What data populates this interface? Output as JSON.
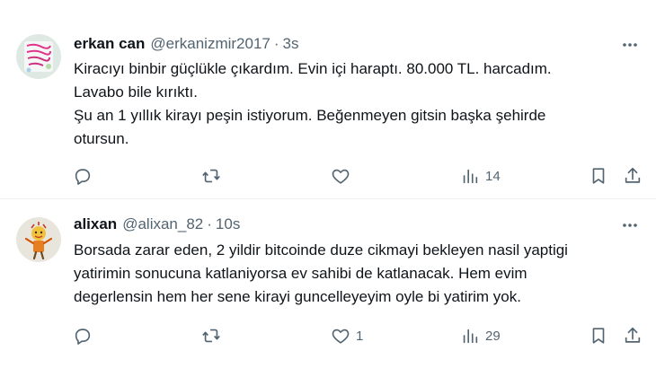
{
  "tweets": [
    {
      "author": {
        "name": "erkan can",
        "handle": "@erkanizmir2017",
        "avatar_icon": "avatar-pink-sticker"
      },
      "separator": "·",
      "time": "3s",
      "text_lines": [
        "Kiracıyı binbir güçlükle çıkardım. Evin içi haraptı. 80.000 TL. harcadım.",
        "Lavabo bile kırıktı.",
        "Şu an 1 yıllık kirayı peşin istiyorum. Beğenmeyen gitsin başka şehirde",
        "otursun."
      ],
      "actions": {
        "reply_count": "",
        "retweet_count": "",
        "like_count": "",
        "views_count": "14"
      }
    },
    {
      "author": {
        "name": "alixan",
        "handle": "@alixan_82",
        "avatar_icon": "avatar-yellow-character"
      },
      "separator": "·",
      "time": "10s",
      "text_lines": [
        "Borsada zarar eden, 2 yildir bitcoinde duze cikmayi bekleyen nasil yaptigi",
        "yatirimin sonucuna katlaniyorsa ev sahibi de katlanacak. Hem evim",
        "degerlensin hem her sene kirayi guncelleyeyim oyle bi yatirim yok."
      ],
      "actions": {
        "reply_count": "",
        "retweet_count": "",
        "like_count": "1",
        "views_count": "29"
      }
    }
  ],
  "colors": {
    "text": "#0f1419",
    "secondary": "#536471",
    "divider": "#eff3f4"
  }
}
